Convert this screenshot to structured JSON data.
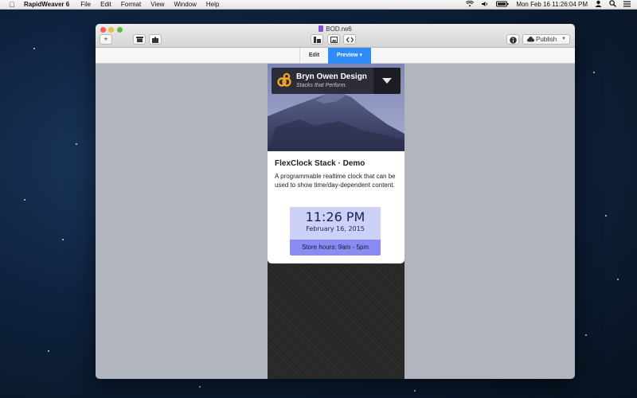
{
  "menubar": {
    "app_name": "RapidWeaver 6",
    "items": [
      "File",
      "Edit",
      "Format",
      "View",
      "Window",
      "Help"
    ],
    "clock": "Mon Feb 16  11:26:04 PM"
  },
  "window": {
    "document_title": "BOD.rw6",
    "add_label": "+",
    "publish_label": "Publish",
    "mode_tabs": {
      "edit": "Edit",
      "preview": "Preview ▾"
    }
  },
  "preview": {
    "brand_name": "Bryn Owen Design",
    "brand_tagline": "Stacks that Perform.",
    "stack_title": "FlexClock Stack · Demo",
    "stack_description": "A programmable realtime clock that can be used to show time/day-dependent content.",
    "clock_time": "11:26 PM",
    "clock_date": "February 16, 2015",
    "store_hours": "Store hours: 9am - 5pm"
  },
  "colors": {
    "preview_tab": "#2f8bf5",
    "clock_bg": "#cdd0f7",
    "hours_bg": "#8a8cf2",
    "logo_accent": "#f5a623"
  }
}
